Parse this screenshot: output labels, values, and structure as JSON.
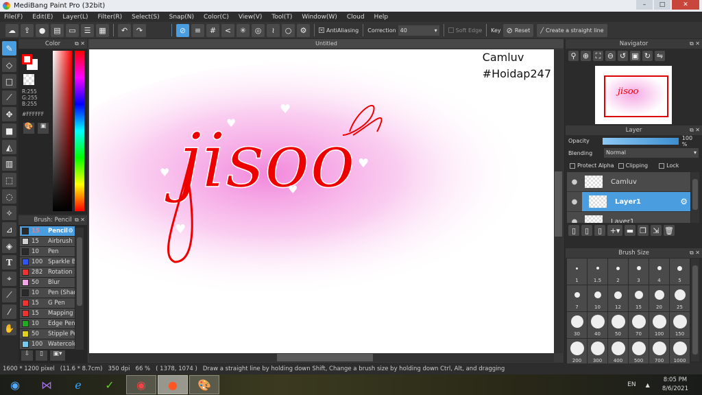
{
  "window": {
    "title": "MediBang Paint Pro (32bit)"
  },
  "menu": [
    "File(F)",
    "Edit(E)",
    "Layer(L)",
    "Filter(R)",
    "Select(S)",
    "Snap(N)",
    "Color(C)",
    "View(V)",
    "Tool(T)",
    "Window(W)",
    "Cloud",
    "Help"
  ],
  "toolbar": {
    "antialiasing_label": "AntiAliasing",
    "antialiasing_checked": true,
    "correction_label": "Correction",
    "correction_value": "40",
    "soft_edge_label": "Soft Edge",
    "key_label": "Key",
    "reset_label": "Reset",
    "straight_line_label": "Create a straight line"
  },
  "color_panel": {
    "title": "Color",
    "r": "R:255",
    "g": "G:255",
    "b": "B:255",
    "hex": "#FFFFFF",
    "primary_color": "#ff0000",
    "secondary_color": "#ffffff"
  },
  "brush_panel": {
    "title": "Brush: Pencil",
    "items": [
      {
        "size": "15",
        "name": "Pencil",
        "color": "#2a2a2a",
        "selected": true
      },
      {
        "size": "15",
        "name": "Airbrush",
        "color": "#d0d0d0"
      },
      {
        "size": "10",
        "name": "Pen",
        "color": "#2a2a2a"
      },
      {
        "size": "100",
        "name": "Sparkle Br",
        "color": "#3355ee"
      },
      {
        "size": "282",
        "name": "Rotation S",
        "color": "#ee3333"
      },
      {
        "size": "50",
        "name": "Blur",
        "color": "#f5a5e5"
      },
      {
        "size": "10",
        "name": "Pen (Shar",
        "color": "#2a2a2a"
      },
      {
        "size": "15",
        "name": "G Pen",
        "color": "#ee3333"
      },
      {
        "size": "15",
        "name": "Mapping P",
        "color": "#ee3333"
      },
      {
        "size": "10",
        "name": "Edge Pen",
        "color": "#22aa22"
      },
      {
        "size": "50",
        "name": "Stipple Pe",
        "color": "#e0d020"
      },
      {
        "size": "100",
        "name": "Watercolo",
        "color": "#77ccee"
      }
    ]
  },
  "document": {
    "tab": "Untitled",
    "text_line1": "Camluv",
    "text_line2": "#Hoidap247",
    "drawing_text": "jisoo"
  },
  "navigator": {
    "title": "Navigator"
  },
  "layer_panel": {
    "title": "Layer",
    "opacity_label": "Opacity",
    "opacity_value": "100 %",
    "opacity_percent": 100,
    "blending_label": "Blending",
    "blending_value": "Normal",
    "protect_alpha": "Protect Alpha",
    "clipping": "Clipping",
    "lock": "Lock",
    "layers": [
      {
        "name": "Camluv",
        "selected": false
      },
      {
        "name": "Layer1",
        "selected": true
      },
      {
        "name": "Layer1",
        "selected": false
      }
    ]
  },
  "brush_size_panel": {
    "title": "Brush Size",
    "sizes": [
      "1",
      "1.5",
      "2",
      "3",
      "4",
      "5",
      "7",
      "10",
      "12",
      "15",
      "20",
      "25",
      "30",
      "40",
      "50",
      "70",
      "100",
      "150",
      "200",
      "300",
      "400",
      "500",
      "700",
      "1000"
    ]
  },
  "status": {
    "pixels": "1600 * 1200 pixel",
    "cm": "(11.6 * 8.7cm)",
    "dpi": "350 dpi",
    "zoom": "66 %",
    "coords": "( 1378, 1074 )",
    "hint": "Draw a straight line by holding down Shift, Change a brush size by holding down Ctrl, Alt, and dragging"
  },
  "taskbar": {
    "lang": "EN",
    "time": "8:05 PM",
    "date": "8/6/2021"
  }
}
